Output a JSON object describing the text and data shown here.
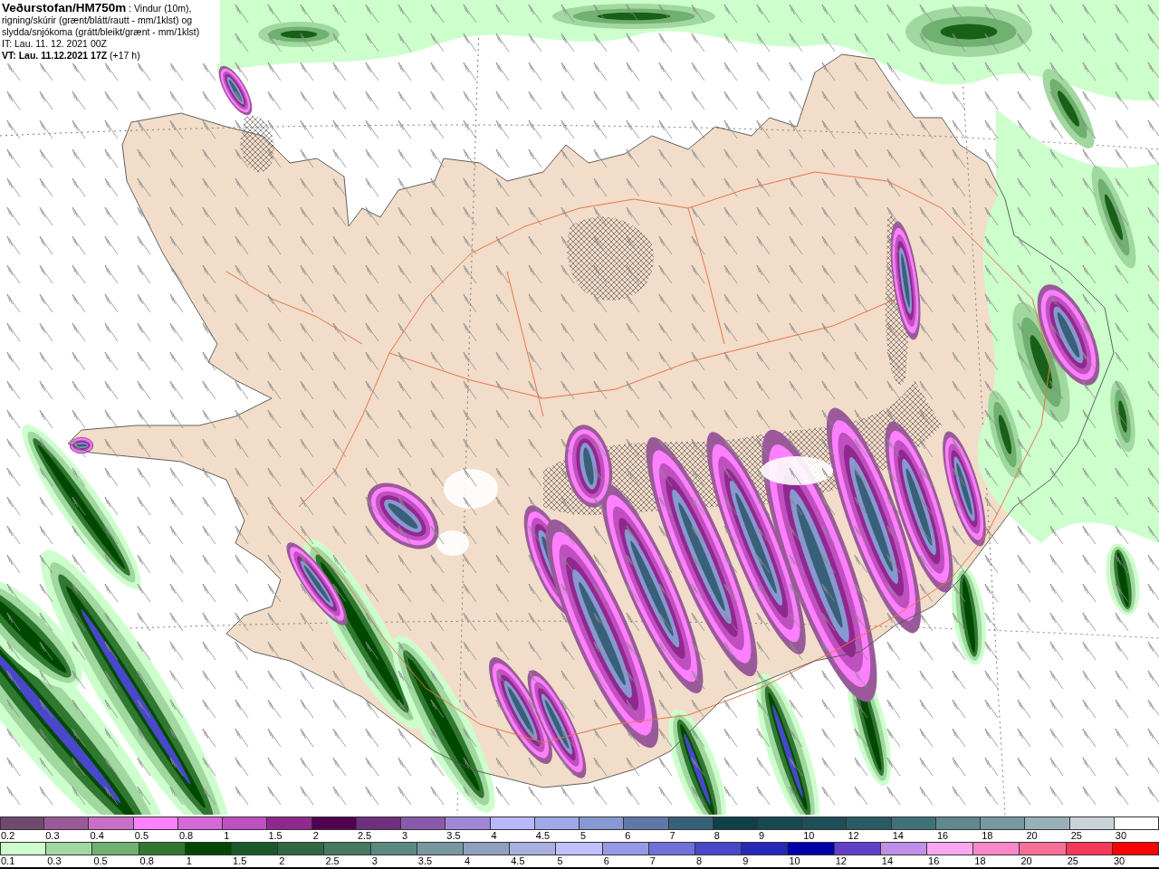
{
  "header": {
    "description": "**Veðurstofan/HM750m** : Vindur (10m), rigning/skúrir (grænt/blátt/rautt - mm/1klst) og slydda/snjókoma (grátt/bleikt/grænt - mm/1klst)",
    "issue_time": "IT: Lau. 11. 12. 2021 00Z",
    "valid_time": "**VT: Lau. 11.12.2021 17Z** (+17 h)"
  },
  "legend_snow": {
    "items": [
      {
        "label": "0.2",
        "color": "#6e4a6e"
      },
      {
        "label": "0.3",
        "color": "#9a5a9a"
      },
      {
        "label": "0.4",
        "color": "#c870c8"
      },
      {
        "label": "0.5",
        "color": "#ff80ff"
      },
      {
        "label": "0.8",
        "color": "#d868d8"
      },
      {
        "label": "1",
        "color": "#c050c0"
      },
      {
        "label": "1.5",
        "color": "#902890"
      },
      {
        "label": "2",
        "color": "#500050"
      },
      {
        "label": "2.5",
        "color": "#6f2f7f"
      },
      {
        "label": "3",
        "color": "#8a5aaa"
      },
      {
        "label": "3.5",
        "color": "#a088d8"
      },
      {
        "label": "4",
        "color": "#b8b8ff"
      },
      {
        "label": "4.5",
        "color": "#a0a8e8"
      },
      {
        "label": "5",
        "color": "#8898d0"
      },
      {
        "label": "6",
        "color": "#6078a8"
      },
      {
        "label": "7",
        "color": "#386078"
      },
      {
        "label": "8",
        "color": "#104048"
      },
      {
        "label": "9",
        "color": "#184850"
      },
      {
        "label": "10",
        "color": "#1e4e58"
      },
      {
        "label": "12",
        "color": "#2a5a64"
      },
      {
        "label": "14",
        "color": "#407078"
      },
      {
        "label": "16",
        "color": "#608890"
      },
      {
        "label": "18",
        "color": "#7898a0"
      },
      {
        "label": "20",
        "color": "#98b0b8"
      },
      {
        "label": "25",
        "color": "#c8d4d8"
      },
      {
        "label": "30",
        "color": "#ffffff"
      }
    ]
  },
  "legend_rain": {
    "items": [
      {
        "label": "0.1",
        "color": "#ccffcc"
      },
      {
        "label": "0.3",
        "color": "#a0d8a0"
      },
      {
        "label": "0.5",
        "color": "#70b070"
      },
      {
        "label": "0.8",
        "color": "#307830"
      },
      {
        "label": "1",
        "color": "#004800"
      },
      {
        "label": "1.5",
        "color": "#1a5a2a"
      },
      {
        "label": "2",
        "color": "#306840"
      },
      {
        "label": "2.5",
        "color": "#487860"
      },
      {
        "label": "3",
        "color": "#5a8a80"
      },
      {
        "label": "3.5",
        "color": "#7898a0"
      },
      {
        "label": "4",
        "color": "#90a0c0"
      },
      {
        "label": "4.5",
        "color": "#a8b0e0"
      },
      {
        "label": "5",
        "color": "#c0c0ff"
      },
      {
        "label": "6",
        "color": "#9898e8"
      },
      {
        "label": "7",
        "color": "#7070d8"
      },
      {
        "label": "8",
        "color": "#4848c8"
      },
      {
        "label": "9",
        "color": "#2828b8"
      },
      {
        "label": "10",
        "color": "#0000a8"
      },
      {
        "label": "12",
        "color": "#6040c8"
      },
      {
        "label": "14",
        "color": "#c090e8"
      },
      {
        "label": "16",
        "color": "#f8a8f0"
      },
      {
        "label": "18",
        "color": "#f888c8"
      },
      {
        "label": "20",
        "color": "#f87098"
      },
      {
        "label": "25",
        "color": "#f83858"
      },
      {
        "label": "30",
        "color": "#ff0000"
      }
    ]
  }
}
